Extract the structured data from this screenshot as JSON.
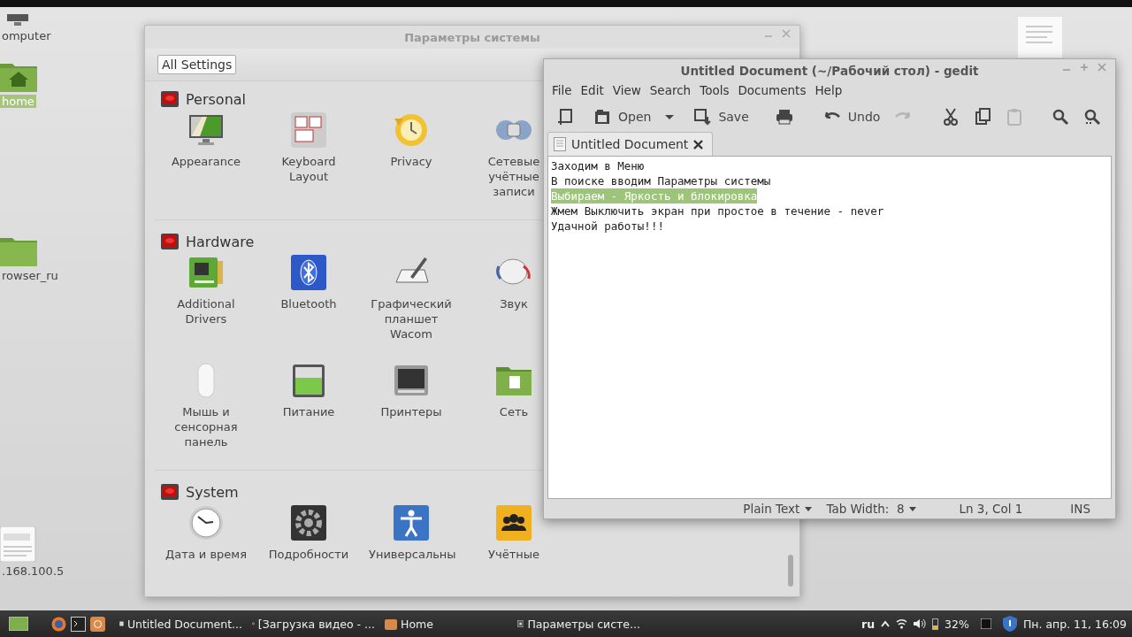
{
  "desktop": {
    "icons": [
      {
        "kind": "computer",
        "label": "omputer",
        "selected": false
      },
      {
        "kind": "home-folder",
        "label": "home",
        "selected": true
      },
      {
        "kind": "folder",
        "label": "rowser_ru",
        "selected": false
      },
      {
        "kind": "text-file",
        "label": ".168.100.5",
        "selected": false
      }
    ]
  },
  "settings_window": {
    "title": "Параметры системы",
    "all_settings_button": "All Settings",
    "sections": [
      {
        "title": "Personal",
        "items": [
          "Appearance",
          "Keyboard Layout",
          "Privacy",
          "Сетевые учётные записи"
        ]
      },
      {
        "title": "Hardware",
        "items": [
          "Additional Drivers",
          "Bluetooth",
          "Графический планшет Wacom",
          "Звук",
          "Мышь и сенсорная панель",
          "Питание",
          "Принтеры",
          "Сеть"
        ]
      },
      {
        "title": "System",
        "items": [
          "Дата и время",
          "Подробности",
          "Универсальны",
          "Учётные"
        ]
      }
    ]
  },
  "gedit": {
    "title": "Untitled Document (~/Рабочий стол) - gedit",
    "menu": [
      "File",
      "Edit",
      "View",
      "Search",
      "Tools",
      "Documents",
      "Help"
    ],
    "toolbar": [
      {
        "kind": "new",
        "disabled": false
      },
      {
        "kind": "open",
        "label": "Open",
        "disabled": false
      },
      {
        "kind": "dropdown",
        "disabled": false
      },
      {
        "kind": "save",
        "label": "Save",
        "disabled": false
      },
      {
        "kind": "print",
        "disabled": false
      },
      {
        "kind": "undo",
        "label": "Undo",
        "disabled": false
      },
      {
        "kind": "redo",
        "disabled": true
      },
      {
        "kind": "cut",
        "disabled": false
      },
      {
        "kind": "copy",
        "disabled": false
      },
      {
        "kind": "paste",
        "disabled": true
      },
      {
        "kind": "find",
        "disabled": false
      },
      {
        "kind": "find-more",
        "disabled": false
      }
    ],
    "tab": "Untitled Document",
    "lines": [
      {
        "text": "Заходим в Меню",
        "selected": false
      },
      {
        "text": "В поиске вводим Параметры системы",
        "selected": false
      },
      {
        "text": "Выбираем - Яркость и блокировка",
        "selected": true
      },
      {
        "text": "Жмем Выключить экран при простое в течение - never",
        "selected": false
      },
      {
        "text": "Удачной работы!!!",
        "selected": false
      }
    ],
    "status": {
      "language": "Plain Text",
      "tab_width": "Tab Width:  8",
      "position": "Ln 3, Col 1",
      "mode": "INS"
    }
  },
  "taskbar": {
    "tasks": [
      "Untitled Document...",
      "[Загрузка видео - ...",
      "Home",
      "Параметры систе..."
    ],
    "keyboard": "ru",
    "battery": "32%",
    "clock": "Пн. апр. 11, 16:09"
  }
}
